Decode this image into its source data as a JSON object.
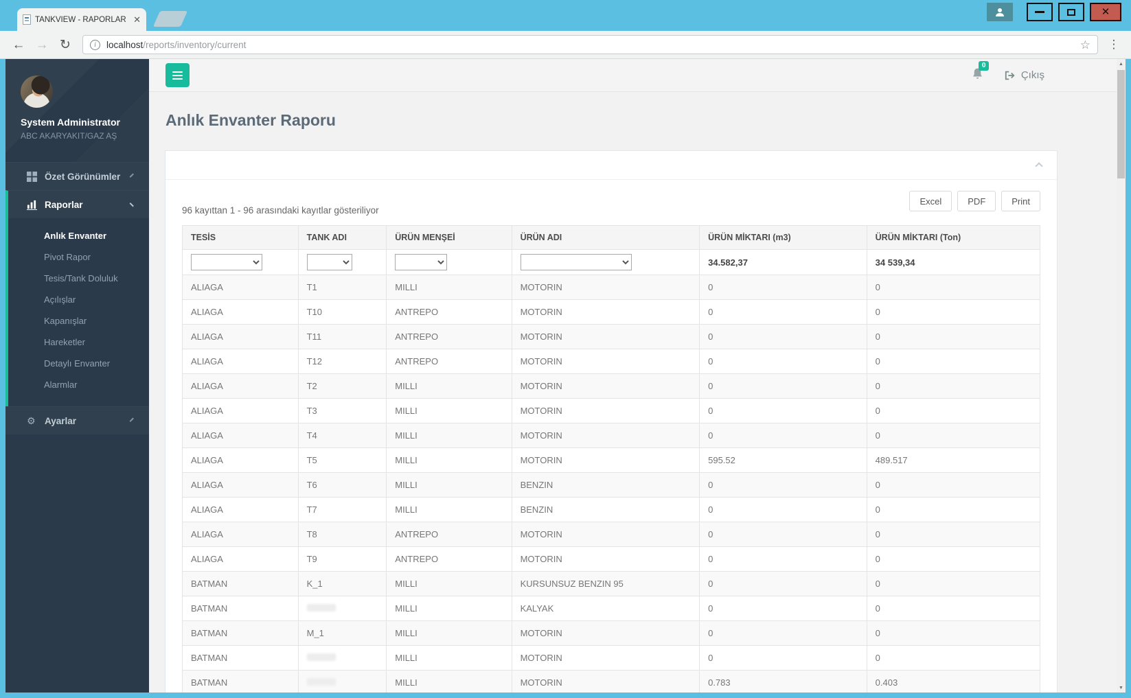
{
  "browser": {
    "tab_title": "TANKVIEW - RAPORLAR",
    "url_host": "localhost",
    "url_path": "/reports/inventory/current"
  },
  "sidebar": {
    "user": {
      "name": "System Administrator",
      "company": "ABC AKARYAKIT/GAZ AŞ"
    },
    "groups": [
      {
        "label": "Özet Görünümler"
      },
      {
        "label": "Raporlar",
        "items": [
          {
            "label": "Anlık Envanter",
            "active": true
          },
          {
            "label": "Pivot Rapor"
          },
          {
            "label": "Tesis/Tank Doluluk"
          },
          {
            "label": "Açılışlar"
          },
          {
            "label": "Kapanışlar"
          },
          {
            "label": "Hareketler"
          },
          {
            "label": "Detaylı Envanter"
          },
          {
            "label": "Alarmlar"
          }
        ]
      },
      {
        "label": "Ayarlar"
      }
    ]
  },
  "topbar": {
    "notification_count": "0",
    "logout_label": "Çıkış"
  },
  "page": {
    "title": "Anlık Envanter Raporu"
  },
  "report": {
    "info_text": "96 kayıttan 1 - 96 arasındaki kayıtlar gösteriliyor",
    "export_buttons": [
      "Excel",
      "PDF",
      "Print"
    ],
    "table": {
      "columns": [
        "TESİS",
        "TANK ADI",
        "ÜRÜN MENŞEİ",
        "ÜRÜN ADI",
        "ÜRÜN MİKTARI (m3)",
        "ÜRÜN MİKTARI (Ton)"
      ],
      "totals": {
        "m3": "34.582,37",
        "ton": "34 539,34"
      },
      "rows": [
        {
          "tesis": "ALIAGA",
          "tank": "T1",
          "mensei": "MILLI",
          "urun": "MOTORIN",
          "m3": "0",
          "ton": "0"
        },
        {
          "tesis": "ALIAGA",
          "tank": "T10",
          "mensei": "ANTREPO",
          "urun": "MOTORIN",
          "m3": "0",
          "ton": "0"
        },
        {
          "tesis": "ALIAGA",
          "tank": "T11",
          "mensei": "ANTREPO",
          "urun": "MOTORIN",
          "m3": "0",
          "ton": "0"
        },
        {
          "tesis": "ALIAGA",
          "tank": "T12",
          "mensei": "ANTREPO",
          "urun": "MOTORIN",
          "m3": "0",
          "ton": "0"
        },
        {
          "tesis": "ALIAGA",
          "tank": "T2",
          "mensei": "MILLI",
          "urun": "MOTORIN",
          "m3": "0",
          "ton": "0"
        },
        {
          "tesis": "ALIAGA",
          "tank": "T3",
          "mensei": "MILLI",
          "urun": "MOTORIN",
          "m3": "0",
          "ton": "0"
        },
        {
          "tesis": "ALIAGA",
          "tank": "T4",
          "mensei": "MILLI",
          "urun": "MOTORIN",
          "m3": "0",
          "ton": "0"
        },
        {
          "tesis": "ALIAGA",
          "tank": "T5",
          "mensei": "MILLI",
          "urun": "MOTORIN",
          "m3": "595.52",
          "ton": "489.517"
        },
        {
          "tesis": "ALIAGA",
          "tank": "T6",
          "mensei": "MILLI",
          "urun": "BENZIN",
          "m3": "0",
          "ton": "0"
        },
        {
          "tesis": "ALIAGA",
          "tank": "T7",
          "mensei": "MILLI",
          "urun": "BENZIN",
          "m3": "0",
          "ton": "0"
        },
        {
          "tesis": "ALIAGA",
          "tank": "T8",
          "mensei": "ANTREPO",
          "urun": "MOTORIN",
          "m3": "0",
          "ton": "0"
        },
        {
          "tesis": "ALIAGA",
          "tank": "T9",
          "mensei": "ANTREPO",
          "urun": "MOTORIN",
          "m3": "0",
          "ton": "0"
        },
        {
          "tesis": "BATMAN",
          "tank": "K_1",
          "mensei": "MILLI",
          "urun": "KURSUNSUZ BENZIN 95",
          "m3": "0",
          "ton": "0"
        },
        {
          "tesis": "BATMAN",
          "tank": "",
          "tank_redacted": true,
          "mensei": "MILLI",
          "urun": "KALYAK",
          "m3": "0",
          "ton": "0"
        },
        {
          "tesis": "BATMAN",
          "tank": "M_1",
          "mensei": "MILLI",
          "urun": "MOTORIN",
          "m3": "0",
          "ton": "0"
        },
        {
          "tesis": "BATMAN",
          "tank": "",
          "tank_redacted": true,
          "mensei": "MILLI",
          "urun": "MOTORIN",
          "m3": "0",
          "ton": "0"
        },
        {
          "tesis": "BATMAN",
          "tank": "",
          "tank_redacted": true,
          "mensei": "MILLI",
          "urun": "MOTORIN",
          "m3": "0.783",
          "ton": "0.403",
          "partial": true
        }
      ]
    }
  },
  "colors": {
    "frame_blue": "#5abfe1",
    "accent_teal": "#18bc9c",
    "sidebar_dark": "#2b3a4a",
    "close_red": "#c35b50"
  }
}
